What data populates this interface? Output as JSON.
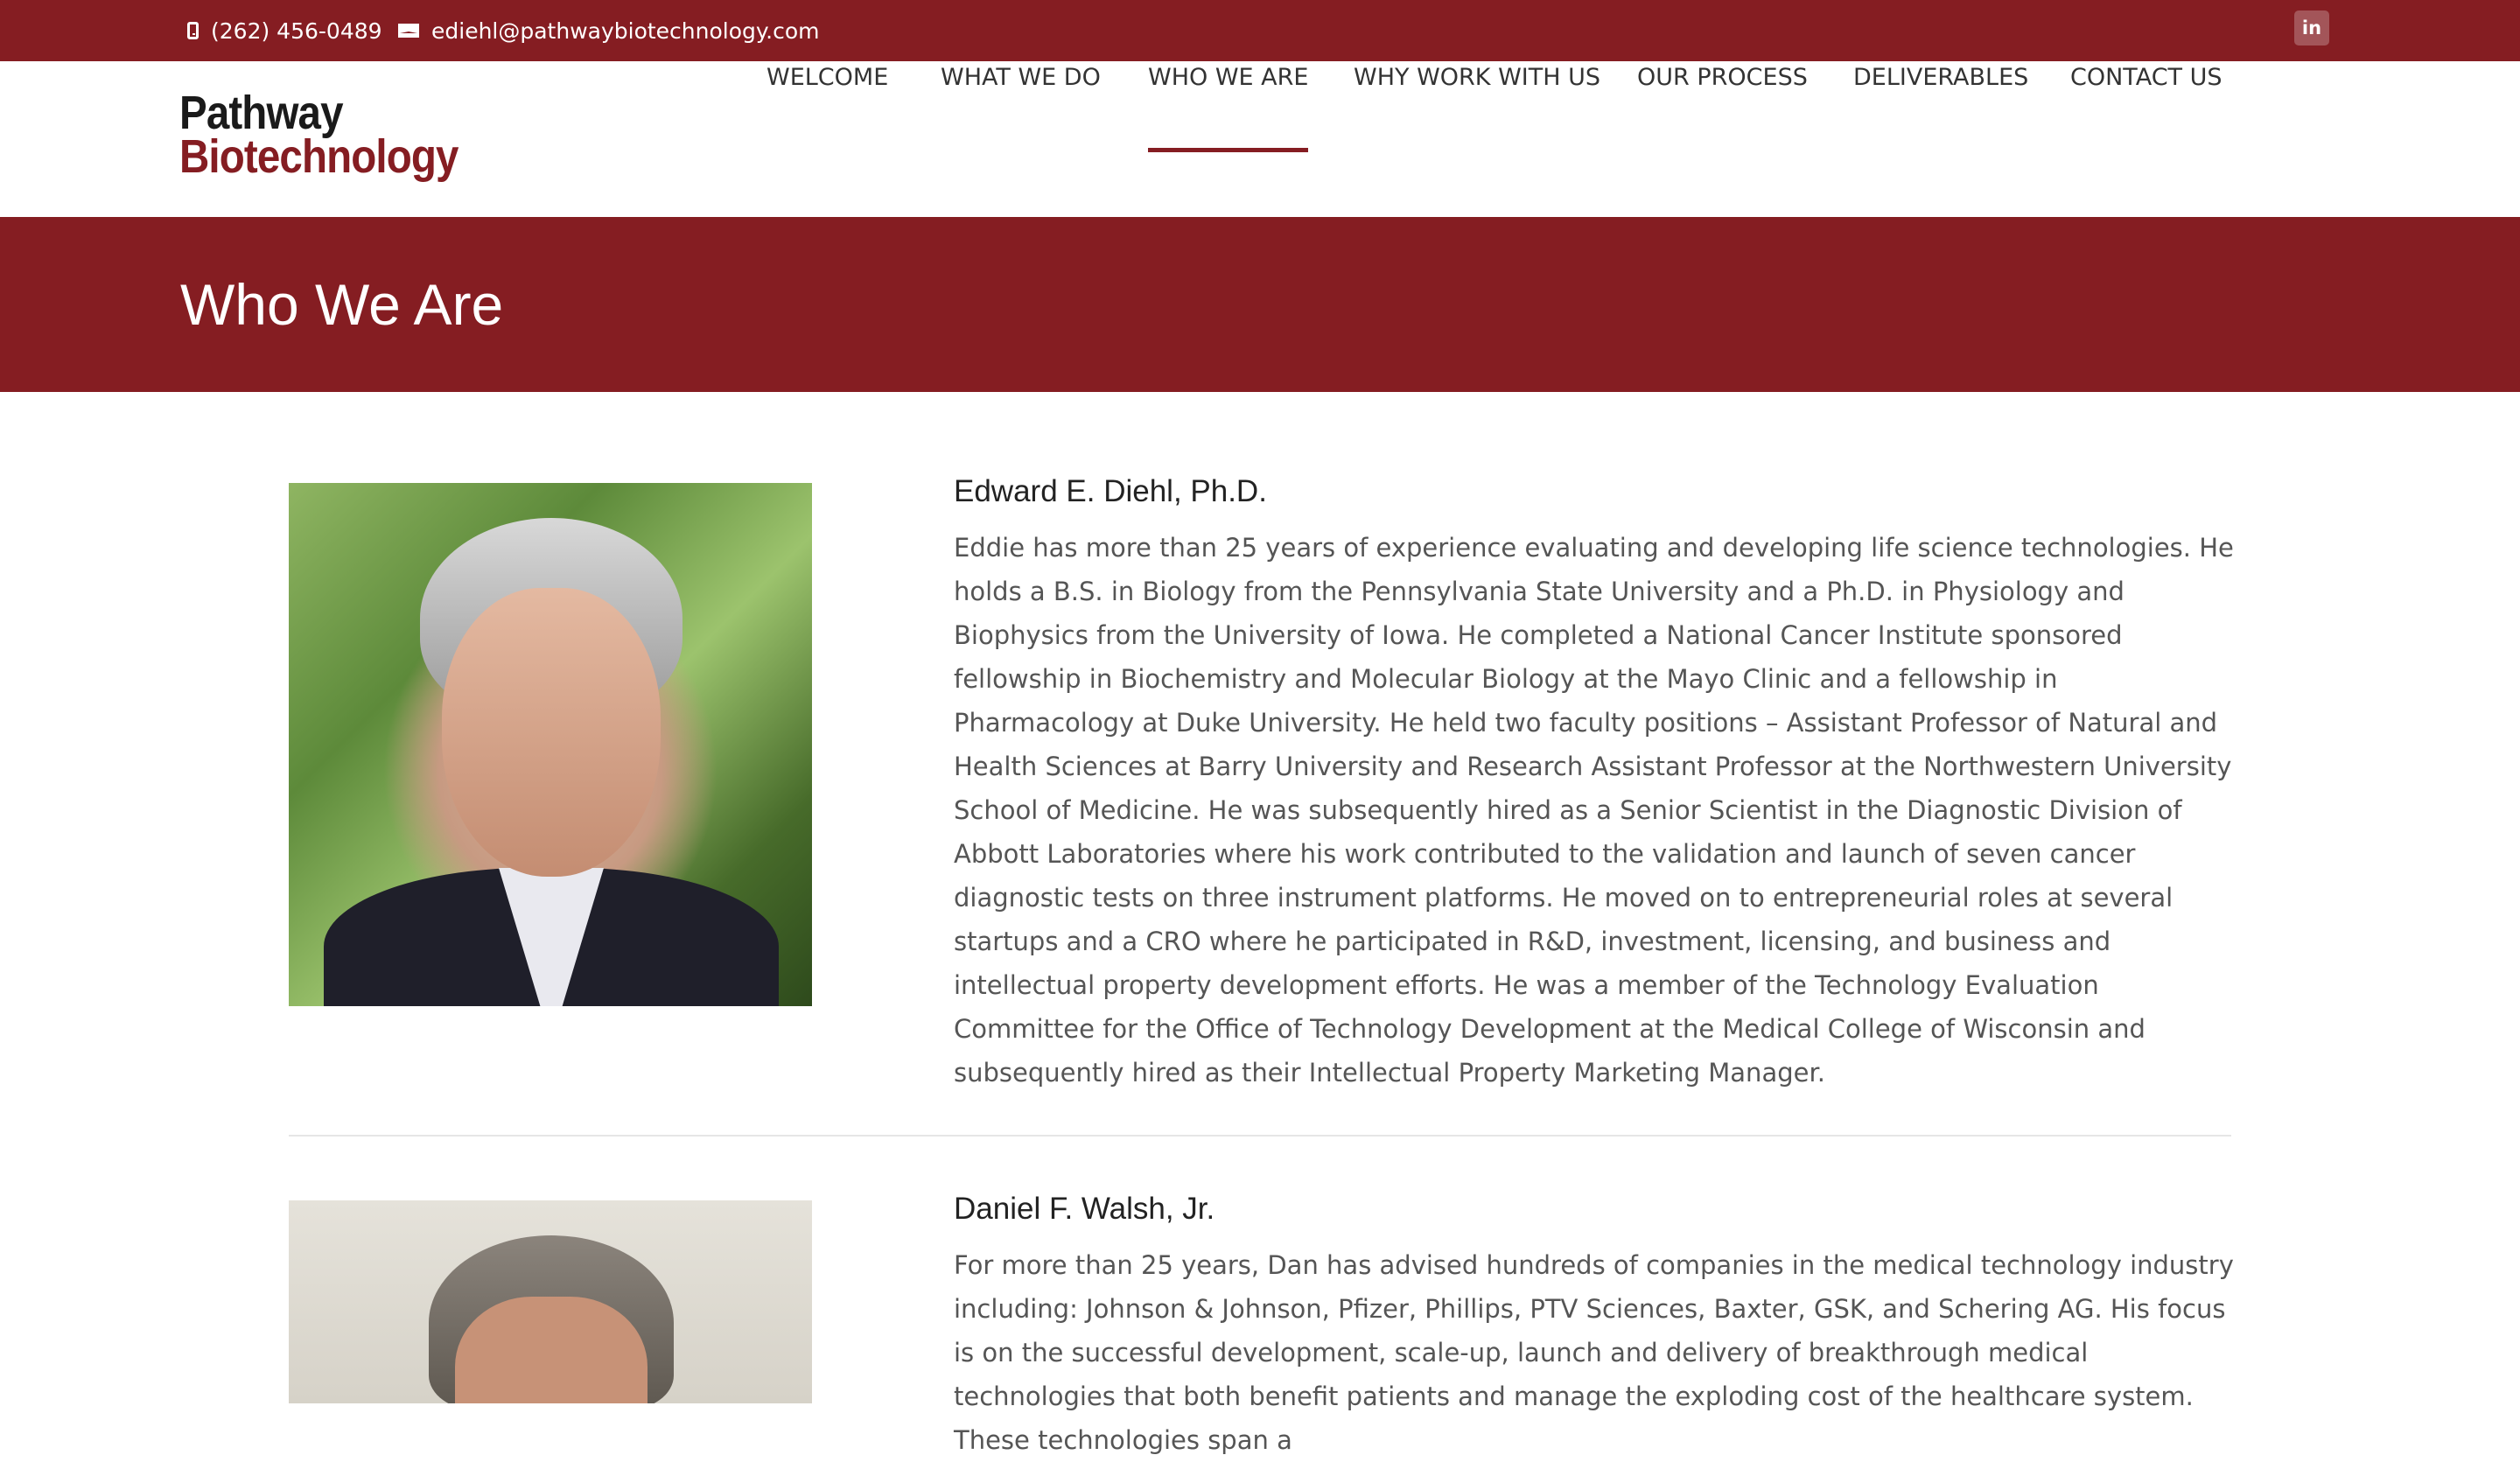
{
  "topbar": {
    "phone": "(262) 456-0489",
    "email": "ediehl@pathwaybiotechnology.com",
    "social": "in"
  },
  "logo": {
    "line1": "Pathway",
    "line2": "Biotechnology"
  },
  "nav": {
    "items": [
      {
        "label": "WELCOME"
      },
      {
        "label": "WHAT WE DO"
      },
      {
        "label": "WHO WE ARE",
        "active": true
      },
      {
        "label": "WHY WORK WITH US"
      },
      {
        "label": "OUR PROCESS"
      },
      {
        "label": "DELIVERABLES"
      },
      {
        "label": "CONTACT US"
      }
    ]
  },
  "page": {
    "title": "Who We Are"
  },
  "profiles": [
    {
      "name": "Edward E. Diehl, Ph.D.",
      "bio": "Eddie has more than 25 years of experience evaluating and developing life science technologies. He holds a B.S. in Biology from the Pennsylvania State University and a Ph.D. in Physiology and Biophysics from the University of Iowa. He completed a National Cancer Institute sponsored fellowship in Biochemistry and Molecular Biology at the Mayo Clinic and a fellowship in Pharmacology at Duke University. He held two faculty positions – Assistant Professor of Natural and Health Sciences at Barry University and Research Assistant Professor at the Northwestern University School of Medicine. He was subsequently hired as a Senior Scientist in the Diagnostic Division of Abbott Laboratories where his work contributed to the validation and launch of seven cancer diagnostic tests on three instrument platforms. He moved on to entrepreneurial roles at several startups and a CRO where he participated in R&D, investment, licensing, and business and intellectual property development efforts. He was a member of the Technology Evaluation Committee for the Office of Technology Development at the Medical College of Wisconsin and subsequently hired as their Intellectual Property Marketing Manager."
    },
    {
      "name": "Daniel F. Walsh, Jr.",
      "bio": "For more than 25 years, Dan has advised hundreds of companies in the medical technology industry including: Johnson & Johnson, Pfizer, Phillips, PTV Sciences, Baxter, GSK, and Schering AG. His focus is on the successful development, scale-up, launch and delivery of breakthrough medical technologies that both benefit patients and manage the exploding cost of the healthcare system. These technologies span a"
    }
  ],
  "colors": {
    "brand": "#851d22",
    "text": "#555555",
    "heading": "#222222"
  }
}
